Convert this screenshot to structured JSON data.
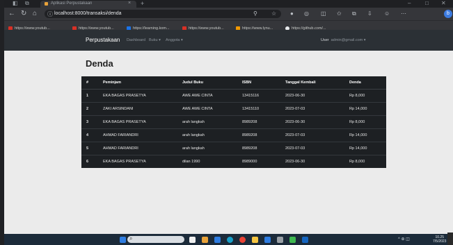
{
  "browser": {
    "tab_title": "Aplikasi Perpustakaan",
    "tab_close": "×",
    "new_tab": "+",
    "url": "localhost:8000/transaksi/denda",
    "profile_initial": "b",
    "minimize": "–",
    "maximize": "□",
    "close": "✕",
    "bookmarks": [
      {
        "label": "https://www.youtub...",
        "color": "#d93025"
      },
      {
        "label": "https://www.youtub...",
        "color": "#d93025"
      },
      {
        "label": "https://learning.kom...",
        "color": "#1a73e8"
      },
      {
        "label": "https://www.youtub...",
        "color": "#d93025"
      },
      {
        "label": "https://www.lynu...",
        "color": "#f29900"
      },
      {
        "label": "https://github.com/...",
        "color": "#e8eaed"
      }
    ]
  },
  "navbar": {
    "brand": "Perpustakaan",
    "links": [
      "Dashboard",
      "Buku ▾",
      "Anggota ▾"
    ],
    "user_label": "User",
    "user_email": "admin@gmail.com ▾"
  },
  "page": {
    "title": "Denda"
  },
  "table": {
    "headers": [
      "#",
      "Peminjam",
      "Judul Buku",
      "ISBN",
      "Tanggal Kembali",
      "Denda"
    ],
    "rows": [
      [
        "1",
        "EKA BAGAS PRASETYA",
        "AWE AWE CINTA",
        "13415116",
        "2023-06-30",
        "Rp 8,000"
      ],
      [
        "2",
        "ZAKI ARSINDANI",
        "AWE AWE CINTA",
        "13415110",
        "2023-07-03",
        "Rp 14,000"
      ],
      [
        "3",
        "EKA BAGAS PRASETYA",
        "arah langkah",
        "8989208",
        "2023-06-30",
        "Rp 8,000"
      ],
      [
        "4",
        "AHMAD FARIANDRI",
        "arah langkah",
        "8989208",
        "2023-07-03",
        "Rp 14,000"
      ],
      [
        "5",
        "AHMAD FARIANDRI",
        "arah langkah",
        "8989208",
        "2023-07-03",
        "Rp 14,000"
      ],
      [
        "6",
        "EKA BAGAS PRASETYA",
        "dilan 1990",
        "8989000",
        "2023-06-30",
        "Rp 8,000"
      ]
    ]
  },
  "taskbar": {
    "search_glyph": "⌕",
    "tray": "^  ⊕  ◫",
    "clock_time": "10.25",
    "clock_date": "7/5/2023",
    "apps": [
      "#2f7de1",
      "#f0f0f0",
      "#e8a23a",
      "#2f7de1",
      "#18a0c9",
      "#ea4335",
      "#f6c542",
      "#2f7de1",
      "#9aa0a6",
      "#3fb950",
      "#1565c0"
    ]
  }
}
